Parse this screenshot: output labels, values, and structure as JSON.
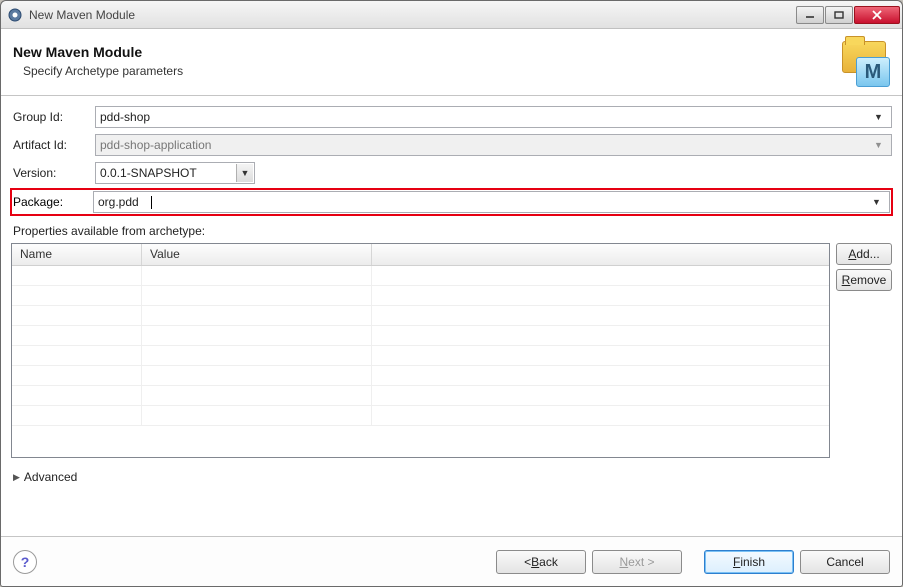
{
  "titlebar": {
    "title": "New Maven Module"
  },
  "header": {
    "heading": "New Maven Module",
    "subheading": "Specify Archetype parameters"
  },
  "form": {
    "group_id_label": "Group Id:",
    "group_id_value": "pdd-shop",
    "artifact_id_label": "Artifact Id:",
    "artifact_id_value": "pdd-shop-application",
    "version_label": "Version:",
    "version_value": "0.0.1-SNAPSHOT",
    "package_label": "Package:",
    "package_value": "org.pdd"
  },
  "properties": {
    "section_label": "Properties available from archetype:",
    "columns": {
      "name": "Name",
      "value": "Value"
    },
    "rows": []
  },
  "side": {
    "add_prefix": "A",
    "add_rest": "dd...",
    "remove_prefix": "R",
    "remove_rest": "emove"
  },
  "advanced": {
    "label": "Advanced"
  },
  "footer": {
    "back": {
      "lt": "< ",
      "u": "B",
      "rest": "ack"
    },
    "next": {
      "u": "N",
      "rest": "ext >"
    },
    "finish": {
      "u": "F",
      "rest": "inish"
    },
    "cancel": "Cancel"
  }
}
